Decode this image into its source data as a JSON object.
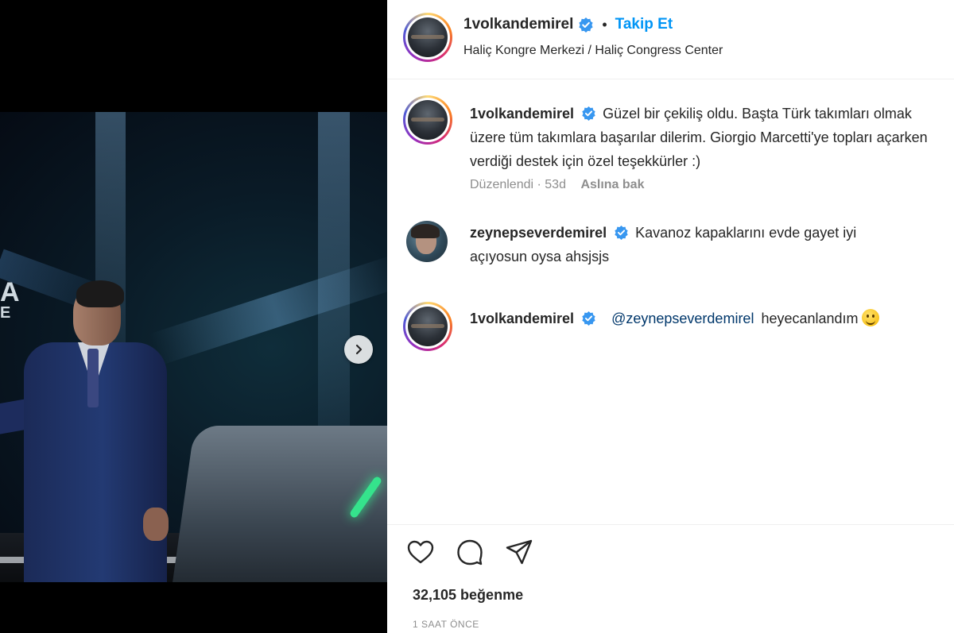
{
  "post": {
    "username": "1volkandemirel",
    "follow_label": "Takip Et",
    "separator": "•",
    "location": "Haliç Kongre Merkezi / Haliç Congress Center"
  },
  "media": {
    "stage_text_big": "A",
    "stage_text_small": "E"
  },
  "comments": [
    {
      "username": "1volkandemirel",
      "text": "Güzel bir çekiliş oldu. Başta Türk takımları olmak üzere tüm takımlara başarılar dilerim. Giorgio Marcetti'ye topları açarken verdiği destek için özel teşekkürler :)",
      "edited_label": "Düzenlendi",
      "age": "53d",
      "meta_separator": " · ",
      "see_translation": "Aslına bak"
    },
    {
      "username": "zeynepseverdemirel",
      "text": "Kavanoz kapaklarını evde gayet iyi açıyosun oysa ahsjsjs"
    },
    {
      "username": "1volkandemirel",
      "mention": "@zeynepseverdemirel",
      "text": "heyecanlandım"
    }
  ],
  "footer": {
    "likes": "32,105 beğenme",
    "timestamp": "1 SAAT ÖNCE"
  },
  "icons": {
    "verified": "verified-badge-icon",
    "like": "heart-icon",
    "comment": "comment-bubble-icon",
    "share": "paper-plane-icon",
    "next": "chevron-right-icon"
  },
  "colors": {
    "link_blue": "#0095f6",
    "verified_blue": "#3897f0",
    "mention": "#00376b",
    "muted": "#8e8e8e"
  }
}
